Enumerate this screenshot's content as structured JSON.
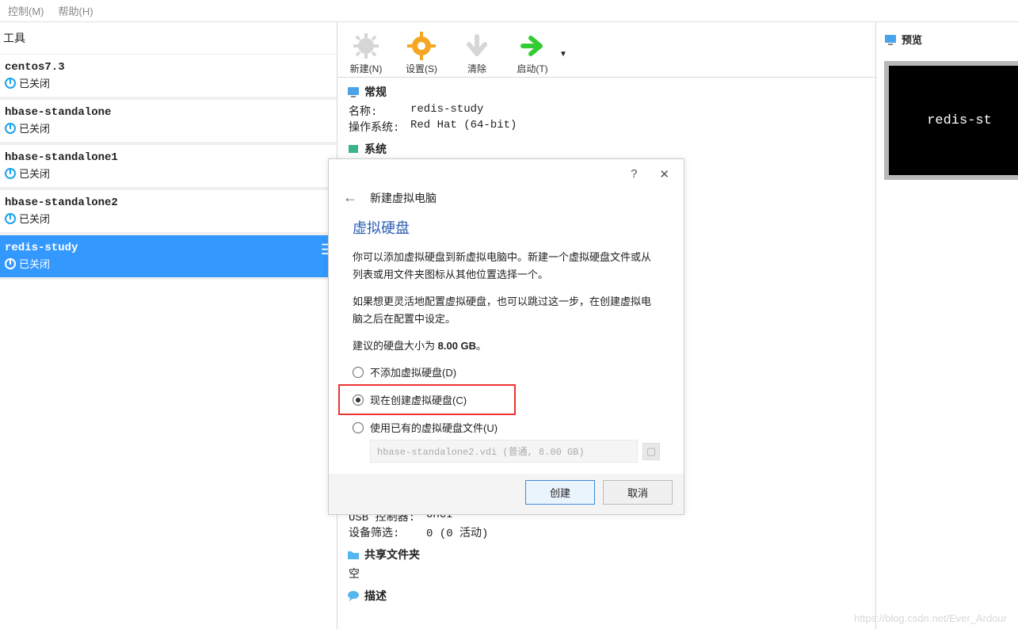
{
  "menu": {
    "control": "控制(M)",
    "help": "帮助(H)"
  },
  "left": {
    "tool_label": "工具",
    "vms": [
      {
        "name": "centos7.3",
        "status": "已关闭",
        "selected": false
      },
      {
        "name": "hbase-standalone",
        "status": "已关闭",
        "selected": false
      },
      {
        "name": "hbase-standalone1",
        "status": "已关闭",
        "selected": false
      },
      {
        "name": "hbase-standalone2",
        "status": "已关闭",
        "selected": false
      },
      {
        "name": "redis-study",
        "status": "已关闭",
        "selected": true
      }
    ]
  },
  "toolbar": {
    "new": "新建(N)",
    "settings": "设置(S)",
    "clear": "清除",
    "start": "启动(T)"
  },
  "details": {
    "general_head": "常规",
    "name_key": "名称:",
    "name_val": "redis-study",
    "os_key": "操作系统:",
    "os_val": "Red Hat (64-bit)",
    "system_head": "系统",
    "usb_ctrl_key": "USB 控制器:",
    "usb_ctrl_val": "OHCI",
    "dev_filter_key": "设备筛选:",
    "dev_filter_val": "0 (0 活动)",
    "shared_head": "共享文件夹",
    "shared_val": "空",
    "desc_head": "描述"
  },
  "preview": {
    "head": "预览",
    "thumb_text": "redis-st"
  },
  "dialog": {
    "title_bar": "新建虚拟电脑",
    "title": "虚拟硬盘",
    "p1": "你可以添加虚拟硬盘到新虚拟电脑中。新建一个虚拟硬盘文件或从列表或用文件夹图标从其他位置选择一个。",
    "p2": "如果想更灵活地配置虚拟硬盘，也可以跳过这一步，在创建虚拟电脑之后在配置中设定。",
    "p3_prefix": "建议的硬盘大小为 ",
    "p3_size": "8.00 GB",
    "p3_suffix": "。",
    "opt_none": "不添加虚拟硬盘(D)",
    "opt_create": "现在创建虚拟硬盘(C)",
    "opt_use_existing": "使用已有的虚拟硬盘文件(U)",
    "file_placeholder": "hbase-standalone2.vdi (普通, 8.00 GB)",
    "create_btn": "创建",
    "cancel_btn": "取消"
  },
  "watermark": "https://blog.csdn.net/Ever_Ardour"
}
